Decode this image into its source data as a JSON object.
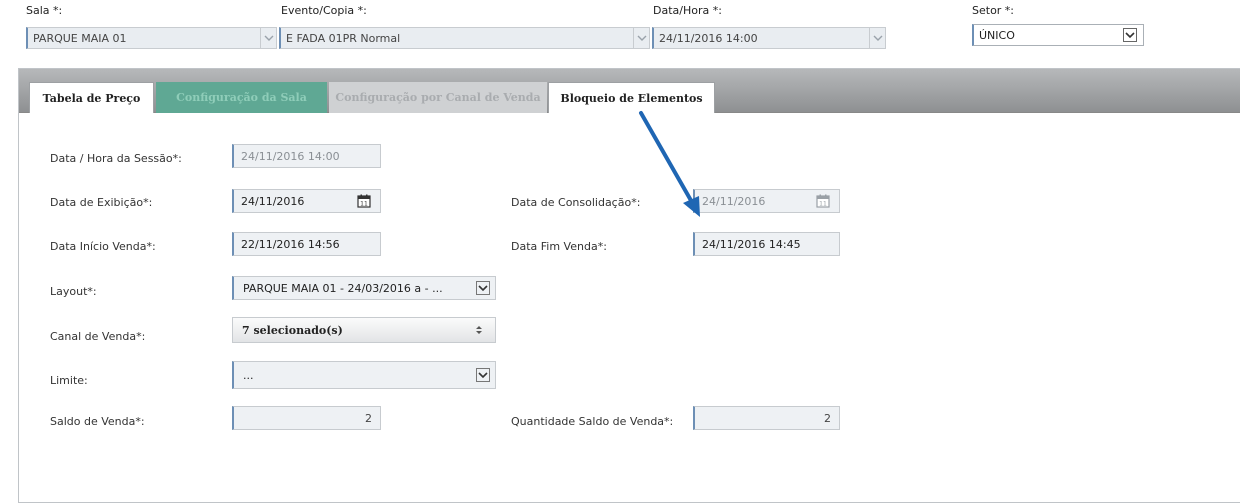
{
  "header": {
    "sala": {
      "label": "Sala *:",
      "value": "PARQUE MAIA 01"
    },
    "evento": {
      "label": "Evento/Copia *:",
      "value": "E FADA 01PR Normal"
    },
    "data_hora": {
      "label": "Data/Hora *:",
      "value": "24/11/2016 14:00"
    },
    "setor": {
      "label": "Setor *:",
      "value": "ÚNICO"
    }
  },
  "tabs": [
    {
      "label": "Tabela de Preço"
    },
    {
      "label": "Configuração da Sala"
    },
    {
      "label": "Configuração por Canal de Venda"
    },
    {
      "label": "Bloqueio de Elementos"
    }
  ],
  "form": {
    "data_hora_sessao": {
      "label": "Data / Hora da Sessão*:",
      "value": "24/11/2016 14:00"
    },
    "data_exibicao": {
      "label": "Data de Exibição*:",
      "value": "24/11/2016"
    },
    "data_consolidacao": {
      "label": "Data de Consolidação*:",
      "value": "24/11/2016"
    },
    "data_inicio_venda": {
      "label": "Data Início Venda*:",
      "value": "22/11/2016 14:56"
    },
    "data_fim_venda": {
      "label": "Data Fim Venda*:",
      "value": "24/11/2016 14:45"
    },
    "layout": {
      "label": "Layout*:",
      "value": "PARQUE MAIA 01 - 24/03/2016 a - ..."
    },
    "canal_venda": {
      "label": "Canal de Venda*:",
      "value": "7 selecionado(s)"
    },
    "limite": {
      "label": "Limite:",
      "value": "..."
    },
    "saldo_venda": {
      "label": "Saldo de Venda*:",
      "value": "2"
    },
    "quantidade_saldo_venda": {
      "label": "Quantidade Saldo de Venda*:",
      "value": "2"
    }
  },
  "icons": {
    "calendar": "calendar-icon",
    "dropdown": "chevron-down-icon",
    "arrow": "annotation-arrow"
  },
  "colors": {
    "accent_border": "#6d8fb5",
    "tab_active": "#5fa894",
    "annotation_arrow": "#1f66b3"
  }
}
